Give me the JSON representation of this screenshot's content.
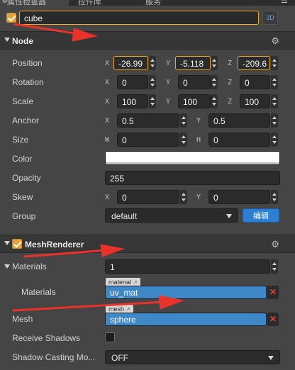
{
  "tabs": {
    "inspector": "属性检查器",
    "library": "控件库",
    "services": "服务"
  },
  "node": {
    "enabled": true,
    "name": "cube",
    "mode_button": "3D"
  },
  "node_section": {
    "title": "Node",
    "position": {
      "label": "Position",
      "x_axis": "X",
      "x": "-26.99",
      "y_axis": "Y",
      "y": "-5.118",
      "z_axis": "Z",
      "z": "-209.6"
    },
    "rotation": {
      "label": "Rotation",
      "x_axis": "X",
      "x": "0",
      "y_axis": "Y",
      "y": "0",
      "z_axis": "Z",
      "z": "0"
    },
    "scale": {
      "label": "Scale",
      "x_axis": "X",
      "x": "100",
      "y_axis": "Y",
      "y": "100",
      "z_axis": "Z",
      "z": "100"
    },
    "anchor": {
      "label": "Anchor",
      "x_axis": "X",
      "x": "0.5",
      "y_axis": "Y",
      "y": "0.5"
    },
    "size": {
      "label": "Size",
      "w_axis": "W",
      "w": "0",
      "h_axis": "H",
      "h": "0"
    },
    "color": {
      "label": "Color",
      "value": "#ffffff"
    },
    "opacity": {
      "label": "Opacity",
      "value": "255"
    },
    "skew": {
      "label": "Skew",
      "x_axis": "X",
      "x": "0",
      "y_axis": "Y",
      "y": "0"
    },
    "group": {
      "label": "Group",
      "value": "default",
      "edit_button": "编辑"
    }
  },
  "mesh_renderer": {
    "enabled": true,
    "title": "MeshRenderer",
    "materials_count": {
      "label": "Materials",
      "value": "1"
    },
    "material_item": {
      "label": "Materials",
      "tag": "material",
      "value": "uv_mat"
    },
    "mesh": {
      "label": "Mesh",
      "tag": "mesh",
      "value": "sphere"
    },
    "receive_shadows": {
      "label": "Receive Shadows",
      "checked": false
    },
    "shadow_casting": {
      "label": "Shadow Casting Mo...",
      "value": "OFF"
    }
  },
  "colors": {
    "accent_orange": "#f4a524",
    "accent_blue": "#2c7fd3",
    "asset_blue": "#3f88c8",
    "annotation_red": "#e8322a"
  }
}
